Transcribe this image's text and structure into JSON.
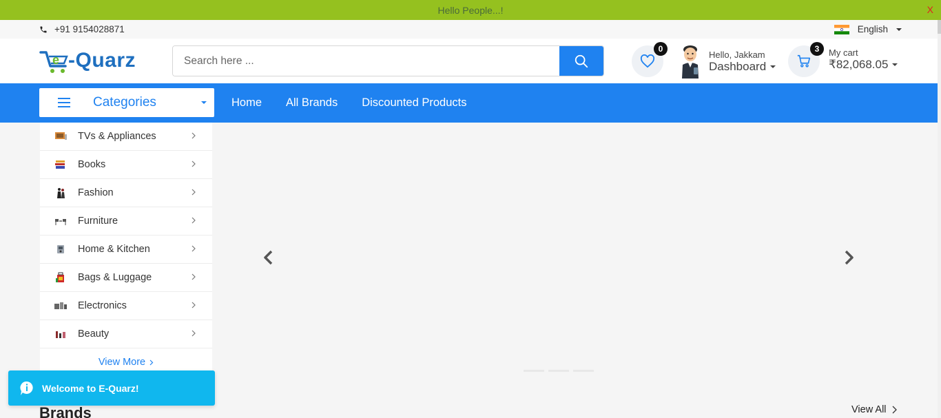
{
  "announcement": {
    "message": "Hello People...!",
    "close": "X"
  },
  "topbar": {
    "phone": "+91 9154028871",
    "language": "English"
  },
  "header": {
    "logo_text": "e-Quarz",
    "search_placeholder": "Search here ...",
    "wishlist_count": "0",
    "user_greeting": "Hello, Jakkam",
    "user_menu": "Dashboard",
    "cart_label": "My cart",
    "cart_count": "3",
    "cart_total": "₹82,068.05"
  },
  "nav": {
    "categories_label": "Categories",
    "links": [
      "Home",
      "All Brands",
      "Discounted Products"
    ]
  },
  "categories": [
    {
      "name": "TVs & Appliances",
      "icon": "tv-icon"
    },
    {
      "name": "Books",
      "icon": "books-icon"
    },
    {
      "name": "Fashion",
      "icon": "fashion-icon"
    },
    {
      "name": "Furniture",
      "icon": "furniture-icon"
    },
    {
      "name": "Home & Kitchen",
      "icon": "kitchen-icon"
    },
    {
      "name": "Bags & Luggage",
      "icon": "bag-icon"
    },
    {
      "name": "Electronics",
      "icon": "electronics-icon"
    },
    {
      "name": "Beauty",
      "icon": "beauty-icon"
    }
  ],
  "view_more": "View More",
  "toast": {
    "message": "Welcome to E-Quarz!"
  },
  "brands": {
    "title": "Brands",
    "view_all": "View All"
  },
  "colors": {
    "primary": "#1f82f0",
    "announcement": "#95c11f",
    "toast": "#10b7ee"
  }
}
